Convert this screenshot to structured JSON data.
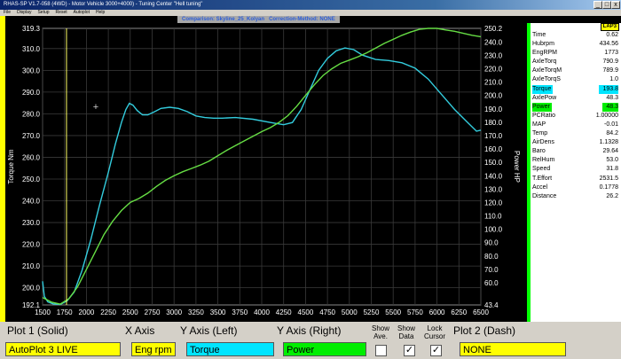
{
  "window": {
    "title": "RHAS-SP V1.7-058  (4WD) - Motor Vehicle 3000+4000) - Tuning Center \"Hell tuning\"",
    "btn_min": "_",
    "btn_max": "□",
    "btn_close": "x"
  },
  "menu": [
    "File",
    "Display",
    "Setup",
    "Reset",
    "Autoplot",
    "Help"
  ],
  "comparison": {
    "label": "Comparison: Skyline_25_Kolyan",
    "method": "Correction-Method: NONE"
  },
  "chart_data": {
    "type": "line",
    "xlabel": "",
    "x_ticks": [
      1500,
      1750,
      2000,
      2250,
      2500,
      2750,
      3000,
      3250,
      3500,
      3750,
      4000,
      4250,
      4500,
      4750,
      5000,
      5250,
      5500,
      5750,
      6000,
      6250,
      6500
    ],
    "xlim": [
      1500,
      6500
    ],
    "ylabel_left": "Torque Nm",
    "ylim_left": [
      192.1,
      319.3
    ],
    "y_ticks_left": [
      "319.3",
      "310.0",
      "300.0",
      "290.0",
      "280.0",
      "270.0",
      "260.0",
      "250.0",
      "240.0",
      "230.0",
      "220.0",
      "210.0",
      "200.0",
      "192.1"
    ],
    "ylabel_right": "Power HP",
    "ylim_right": [
      43.4,
      250.2
    ],
    "y_ticks_right": [
      "250.2",
      "240.0",
      "230.0",
      "220.0",
      "210.0",
      "200.0",
      "190.0",
      "180.0",
      "170.0",
      "160.0",
      "150.0",
      "140.0",
      "130.0",
      "120.0",
      "110.0",
      "100.0",
      "90.0",
      "80.0",
      "70.0",
      "60.0",
      "43.4"
    ],
    "series": [
      {
        "name": "Torque",
        "axis": "left",
        "color": "#33ccdd",
        "points": [
          [
            1500,
            203
          ],
          [
            1520,
            196
          ],
          [
            1560,
            193.5
          ],
          [
            1620,
            192.6
          ],
          [
            1700,
            192.3
          ],
          [
            1780,
            194
          ],
          [
            1860,
            198
          ],
          [
            1950,
            208
          ],
          [
            2050,
            222
          ],
          [
            2150,
            238
          ],
          [
            2250,
            253
          ],
          [
            2330,
            266
          ],
          [
            2400,
            276
          ],
          [
            2450,
            282
          ],
          [
            2490,
            284.8
          ],
          [
            2530,
            284
          ],
          [
            2580,
            281.5
          ],
          [
            2640,
            279.5
          ],
          [
            2700,
            279.5
          ],
          [
            2780,
            281
          ],
          [
            2850,
            282.5
          ],
          [
            2950,
            283
          ],
          [
            3050,
            282.5
          ],
          [
            3150,
            281
          ],
          [
            3250,
            279
          ],
          [
            3350,
            278.3
          ],
          [
            3450,
            278
          ],
          [
            3550,
            278
          ],
          [
            3700,
            278.3
          ],
          [
            3900,
            277.5
          ],
          [
            4100,
            276
          ],
          [
            4250,
            275
          ],
          [
            4350,
            276
          ],
          [
            4450,
            282
          ],
          [
            4550,
            291
          ],
          [
            4650,
            300
          ],
          [
            4750,
            305.5
          ],
          [
            4850,
            309
          ],
          [
            4950,
            310.3
          ],
          [
            5050,
            309.5
          ],
          [
            5150,
            307
          ],
          [
            5300,
            305
          ],
          [
            5450,
            304.5
          ],
          [
            5600,
            303.5
          ],
          [
            5750,
            301
          ],
          [
            5900,
            296
          ],
          [
            6050,
            289
          ],
          [
            6200,
            282
          ],
          [
            6350,
            276
          ],
          [
            6450,
            272
          ],
          [
            6500,
            272.5
          ]
        ]
      },
      {
        "name": "Power",
        "axis": "right",
        "color": "#66dd44",
        "points": [
          [
            1500,
            49
          ],
          [
            1600,
            45.5
          ],
          [
            1700,
            44
          ],
          [
            1800,
            48
          ],
          [
            1900,
            57
          ],
          [
            2000,
            70
          ],
          [
            2100,
            83
          ],
          [
            2200,
            96
          ],
          [
            2300,
            106
          ],
          [
            2400,
            114
          ],
          [
            2500,
            120
          ],
          [
            2600,
            123
          ],
          [
            2700,
            127
          ],
          [
            2800,
            132
          ],
          [
            2900,
            136.5
          ],
          [
            3000,
            140
          ],
          [
            3100,
            143
          ],
          [
            3200,
            145.5
          ],
          [
            3300,
            148
          ],
          [
            3400,
            151
          ],
          [
            3500,
            155
          ],
          [
            3600,
            159
          ],
          [
            3700,
            162.5
          ],
          [
            3800,
            166
          ],
          [
            3900,
            169.5
          ],
          [
            4000,
            173
          ],
          [
            4100,
            176
          ],
          [
            4200,
            180
          ],
          [
            4300,
            185
          ],
          [
            4400,
            192
          ],
          [
            4500,
            200
          ],
          [
            4600,
            208
          ],
          [
            4700,
            215
          ],
          [
            4800,
            220
          ],
          [
            4900,
            224
          ],
          [
            5000,
            226.5
          ],
          [
            5100,
            229
          ],
          [
            5200,
            232
          ],
          [
            5300,
            235.5
          ],
          [
            5400,
            239
          ],
          [
            5500,
            242
          ],
          [
            5600,
            245
          ],
          [
            5700,
            247.5
          ],
          [
            5800,
            249.5
          ],
          [
            5900,
            250.2
          ],
          [
            6000,
            250.2
          ],
          [
            6100,
            249
          ],
          [
            6200,
            248
          ],
          [
            6300,
            246.5
          ],
          [
            6400,
            245
          ],
          [
            6500,
            244
          ]
        ]
      }
    ],
    "grid": true,
    "cursor_marker": "+"
  },
  "stats": {
    "header": "LAP3",
    "rows": [
      {
        "label": "Time",
        "value": "0.62",
        "hl": ""
      },
      {
        "label": "Hubrpm",
        "value": "434.56",
        "hl": ""
      },
      {
        "label": "EngRPM",
        "value": "1773",
        "hl": ""
      },
      {
        "label": "AxleTorq",
        "value": "790.9",
        "hl": ""
      },
      {
        "label": "AxleTorqM",
        "value": "789.9",
        "hl": ""
      },
      {
        "label": "AxleTorqS",
        "value": "1.0",
        "hl": ""
      },
      {
        "label": "Torque",
        "value": "193.8",
        "hl": "cyan"
      },
      {
        "label": "AxlePow",
        "value": "48.3",
        "hl": ""
      },
      {
        "label": "Power",
        "value": "48.3",
        "hl": "green"
      },
      {
        "label": "PCRatio",
        "value": "1.00000",
        "hl": ""
      },
      {
        "label": "MAP",
        "value": "-0.01",
        "hl": ""
      },
      {
        "label": "Temp",
        "value": "84.2",
        "hl": ""
      },
      {
        "label": "AirDens",
        "value": "1.1328",
        "hl": ""
      },
      {
        "label": "Baro",
        "value": "29.64",
        "hl": ""
      },
      {
        "label": "RelHum",
        "value": "53.0",
        "hl": ""
      },
      {
        "label": "Speed",
        "value": "31.8",
        "hl": ""
      },
      {
        "label": "T.Effort",
        "value": "2531.5",
        "hl": ""
      },
      {
        "label": "Accel",
        "value": "0.1778",
        "hl": ""
      },
      {
        "label": "Distance",
        "value": "26.2",
        "hl": ""
      }
    ]
  },
  "controls": {
    "plot1_label": "Plot 1 (Solid)",
    "plot1_value": "AutoPlot 3 LIVE",
    "xaxis_label": "X Axis",
    "xaxis_value": "Eng rpm",
    "yleft_label": "Y Axis (Left)",
    "yleft_value": "Torque",
    "yright_label": "Y Axis (Right)",
    "yright_value": "Power",
    "show_ave_label": "Show Ave.",
    "show_data_label": "Show Data",
    "lock_cursor_label": "Lock Cursor",
    "show_data_check": "✓",
    "lock_cursor_check": "✓",
    "plot2_label": "Plot 2 (Dash)",
    "plot2_value": "NONE",
    "colors": {
      "yellow": "#ffff00",
      "cyan": "#00e5ff",
      "green": "#00ee00"
    }
  }
}
